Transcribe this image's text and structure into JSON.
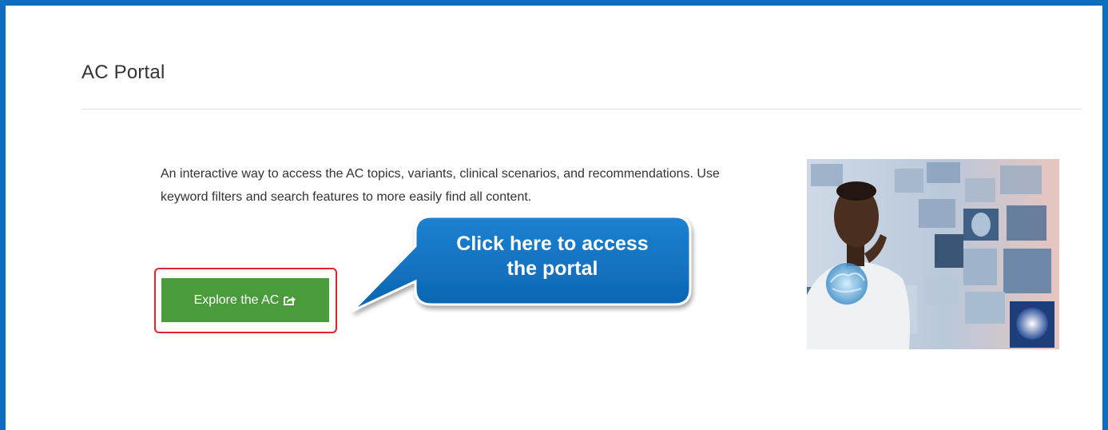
{
  "portal": {
    "title": "AC Portal",
    "description": "An interactive way to access the AC topics, variants, clinical scenarios, and recommendations. Use keyword filters and search features to more easily find all content.",
    "explore_button_label": "Explore the AC",
    "explore_button_icon": "external-link-icon",
    "hero_image": "doctor-with-medical-scan-screens"
  },
  "annotation": {
    "callout_line1": "Click here to access",
    "callout_line2": "the portal",
    "callout_color": "#0f6fbf",
    "highlight_color": "#e2252b"
  },
  "colors": {
    "frame_border": "#0f6fbf",
    "button_green": "#4a9b3b",
    "text": "#333333"
  }
}
